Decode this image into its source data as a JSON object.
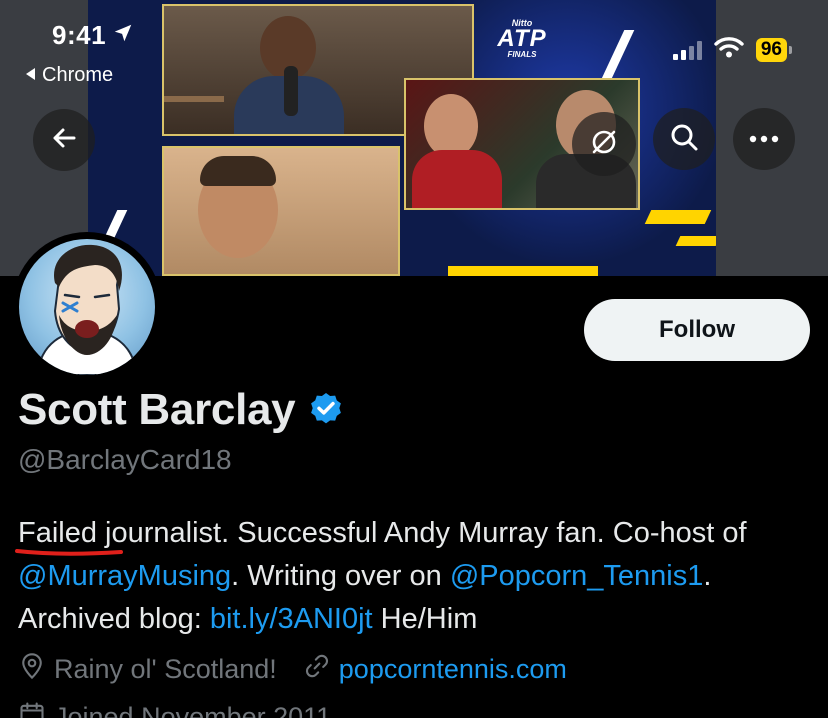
{
  "status_bar": {
    "time": "9:41",
    "back_app": "Chrome",
    "battery": "96",
    "battery_color": "#ffd60a"
  },
  "banner": {
    "logo_top": "Nitto",
    "logo_main": "ATP",
    "logo_bottom": "FINALS"
  },
  "nav": {
    "back_icon": "arrow-left-icon",
    "notify_icon": "bell-off-icon",
    "search_icon": "search-icon",
    "more_icon": "more-horizontal-icon"
  },
  "profile": {
    "display_name": "Scott Barclay",
    "verified": true,
    "verified_color": "#1d9bf0",
    "handle": "@BarclayCard18",
    "follow_label": "Follow",
    "bio": {
      "failed": "Failed",
      "part1": " journalist. Successful Andy Murray fan. Co-host of ",
      "mention1": "@MurrayMusing",
      "part2": ". Writing over on ",
      "mention2": "@Popcorn_Tennis1",
      "part3": ". Archived blog: ",
      "link": "bit.ly/3ANI0jt",
      "part4": " He/Him"
    },
    "location": "Rainy ol' Scotland!",
    "website": "popcorntennis.com",
    "joined": "Joined November 2011"
  },
  "colors": {
    "accent": "#1d9bf0",
    "annotation_underline": "#e0201b",
    "follow_bg": "#eff3f4"
  }
}
